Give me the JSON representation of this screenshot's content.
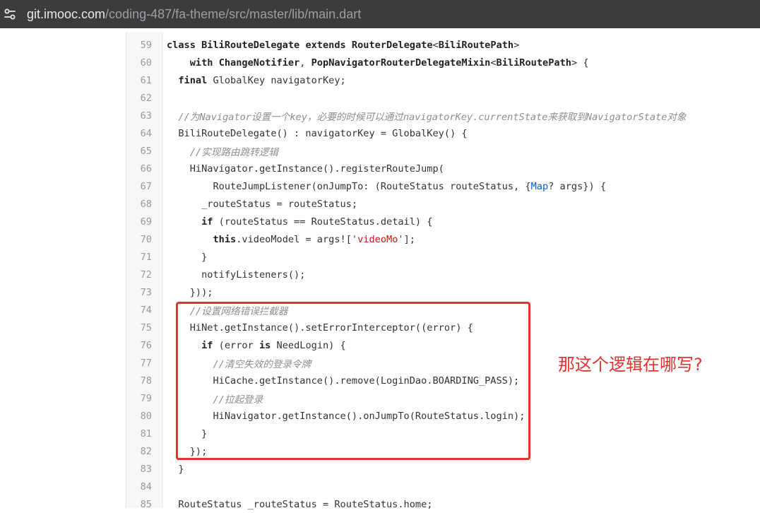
{
  "browser": {
    "url_host": "git.imooc.com",
    "url_path": "/coding-487/fa-theme/src/master/lib/main.dart",
    "site_icon": "tune-icon"
  },
  "code": {
    "lines": [
      {
        "n": "59",
        "html": "<span class=\"kw\">class</span> <span class=\"kw\">BiliRouteDelegate</span> <span class=\"kw\">extends</span> <span class=\"kw\">RouterDelegate</span><<span class=\"kw\">BiliRoutePath</span>>"
      },
      {
        "n": "60",
        "html": "    <span class=\"kw\">with</span> <span class=\"kw\">ChangeNotifier</span>, <span class=\"kw\">PopNavigatorRouterDelegateMixin</span><<span class=\"kw\">BiliRoutePath</span>> {"
      },
      {
        "n": "61",
        "html": "  <span class=\"kw\">final</span> GlobalKey<NavigatorState> navigatorKey;"
      },
      {
        "n": "62",
        "html": ""
      },
      {
        "n": "63",
        "html": "  <span class=\"cm\">//为Navigator设置一个key，必要的时候可以通过navigatorKey.currentState来获取到NavigatorState对象</span>"
      },
      {
        "n": "64",
        "html": "  BiliRouteDelegate() : navigatorKey = GlobalKey<NavigatorState>() {"
      },
      {
        "n": "65",
        "html": "    <span class=\"cm\">//实现路由跳转逻辑</span>"
      },
      {
        "n": "66",
        "html": "    HiNavigator.getInstance().registerRouteJump("
      },
      {
        "n": "67",
        "html": "        RouteJumpListener(onJumpTo: (RouteStatus routeStatus, {<span class=\"bl\">Map</span>? args}) {"
      },
      {
        "n": "68",
        "html": "      _routeStatus = routeStatus;"
      },
      {
        "n": "69",
        "html": "      <span class=\"kw\">if</span> (routeStatus == RouteStatus.detail) {"
      },
      {
        "n": "70",
        "html": "        <span class=\"kw\">this</span>.videoModel = args![<span class=\"str\">'videoMo'</span>];"
      },
      {
        "n": "71",
        "html": "      }"
      },
      {
        "n": "72",
        "html": "      notifyListeners();"
      },
      {
        "n": "73",
        "html": "    }));"
      },
      {
        "n": "74",
        "html": "    <span class=\"cm\">//设置网络错误拦截器</span>"
      },
      {
        "n": "75",
        "html": "    HiNet.getInstance().setErrorInterceptor((error) {"
      },
      {
        "n": "76",
        "html": "      <span class=\"kw\">if</span> (error <span class=\"kw\">is</span> NeedLogin) {"
      },
      {
        "n": "77",
        "html": "        <span class=\"cm\">//清空失效的登录令牌</span>"
      },
      {
        "n": "78",
        "html": "        HiCache.getInstance().remove(LoginDao.BOARDING_PASS);"
      },
      {
        "n": "79",
        "html": "        <span class=\"cm\">//拉起登录</span>"
      },
      {
        "n": "80",
        "html": "        HiNavigator.getInstance().onJumpTo(RouteStatus.login);"
      },
      {
        "n": "81",
        "html": "      }"
      },
      {
        "n": "82",
        "html": "    });"
      },
      {
        "n": "83",
        "html": "  }"
      },
      {
        "n": "84",
        "html": ""
      },
      {
        "n": "85",
        "html": "  RouteStatus _routeStatus = RouteStatus.home;"
      }
    ]
  },
  "annotation": {
    "text": "那这个逻辑在哪写?",
    "color": "#e5322d"
  }
}
